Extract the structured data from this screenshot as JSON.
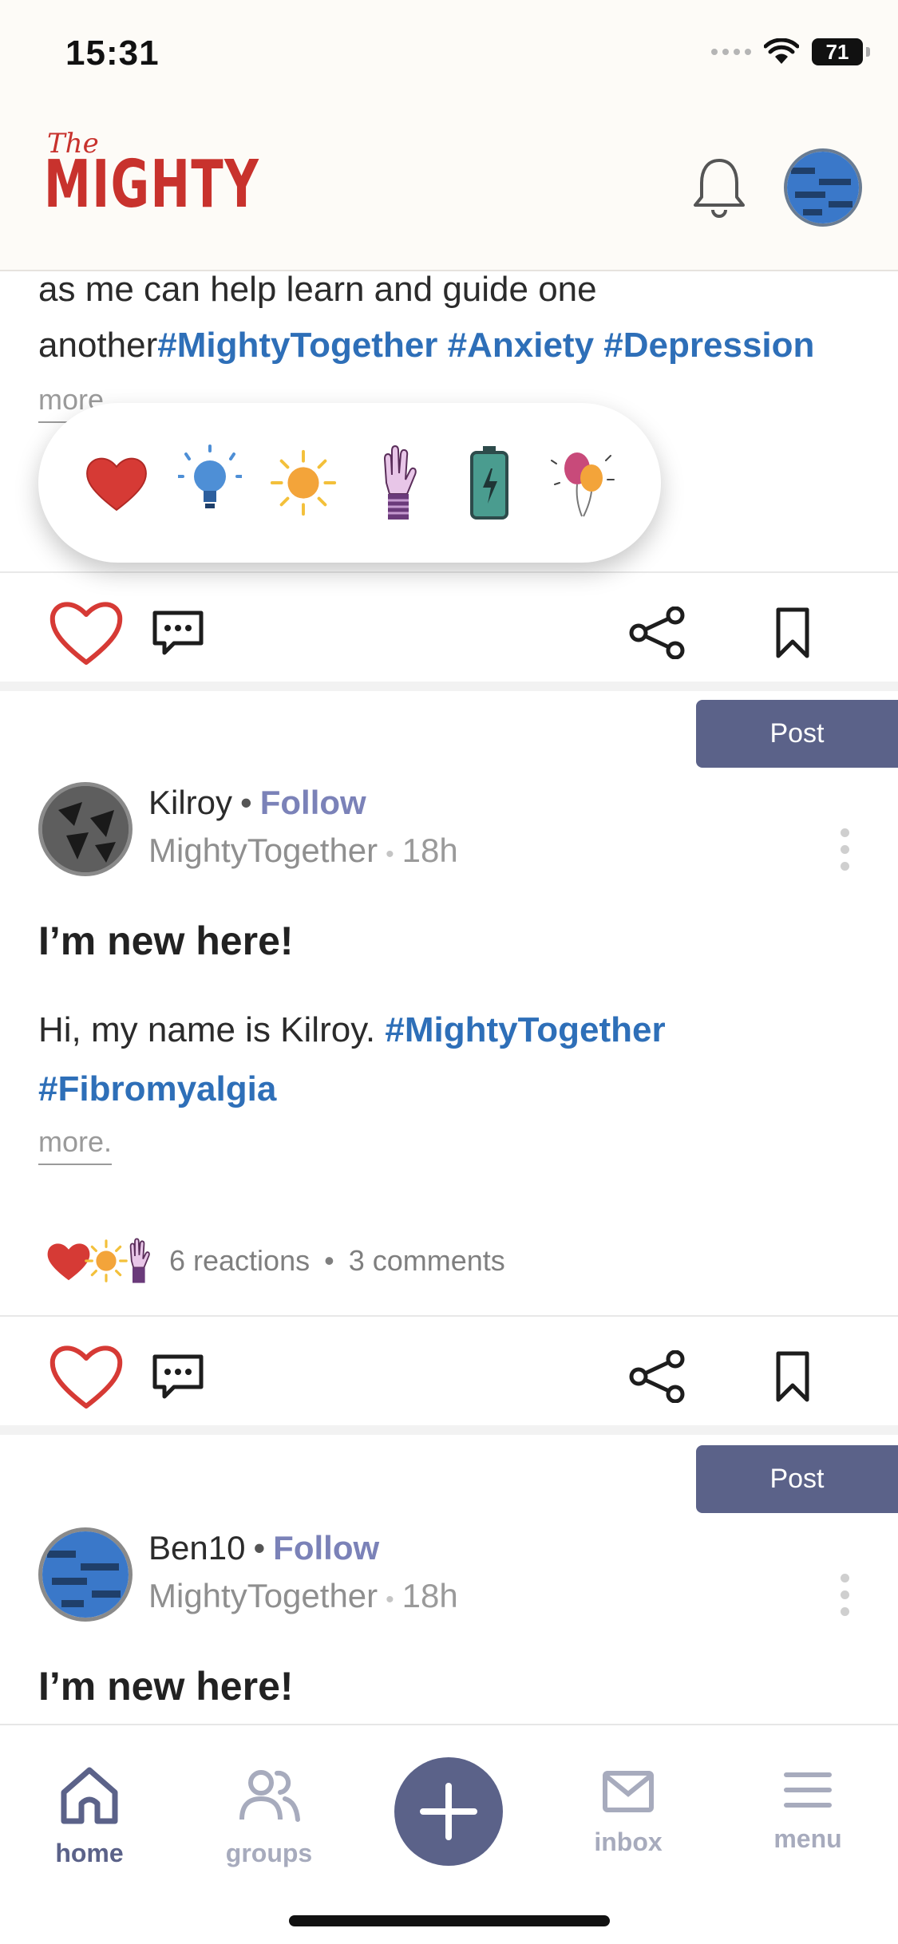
{
  "status_bar": {
    "time": "15:31",
    "battery": "71"
  },
  "header": {
    "logo_the": "The",
    "logo_mighty": "MIGHTY"
  },
  "previous_post": {
    "line1": "as me can help learn and guide one",
    "line2_text": "another",
    "line2_tags": "#MightyTogether #Anxiety #Depression",
    "more": "more"
  },
  "reaction_picker": {
    "items": [
      "heart-icon",
      "lightbulb-icon",
      "sun-icon",
      "raised-hand-icon",
      "battery-icon",
      "balloons-icon"
    ]
  },
  "posts": [
    {
      "post_button": "Post",
      "author": "Kilroy",
      "follow": "Follow",
      "group": "MightyTogether",
      "time": "18h",
      "title": "I’m new here!",
      "body_text": "Hi, my name is Kilroy.",
      "body_tag1": "#MightyTogether",
      "body_tag2": "#Fibromyalgia",
      "more": "more.",
      "reactions": "6 reactions",
      "comments": "3 comments"
    },
    {
      "post_button": "Post",
      "author": "Ben10",
      "follow": "Follow",
      "group": "MightyTogether",
      "time": "18h",
      "title": "I’m new here!"
    }
  ],
  "bottom_nav": {
    "home": "home",
    "groups": "groups",
    "inbox": "inbox",
    "menu": "menu"
  },
  "colors": {
    "brand_red": "#c8322d",
    "accent": "#5b6289",
    "hashtag": "#2e6fb8",
    "follow": "#7b82b8"
  }
}
